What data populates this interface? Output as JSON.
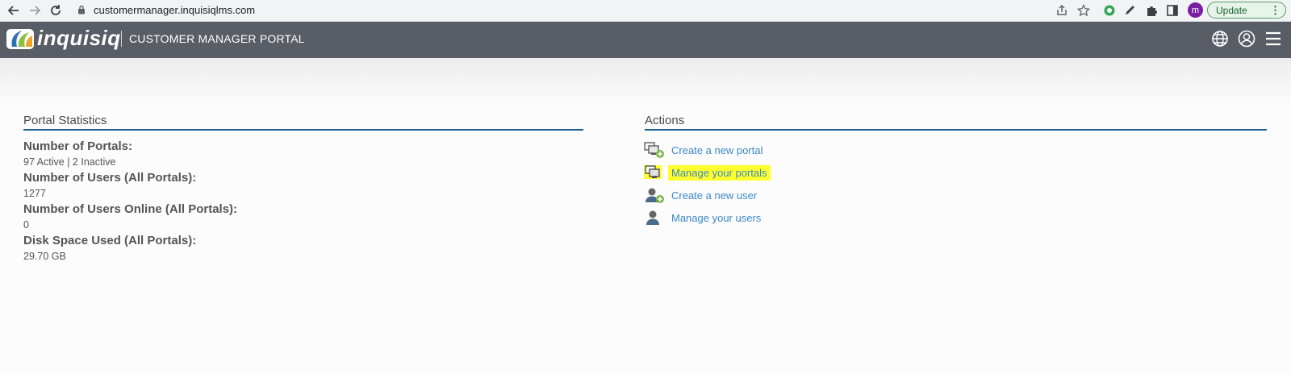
{
  "browser": {
    "url": "customermanager.inquisiqlms.com",
    "profile_initial": "m",
    "update_label": "Update"
  },
  "header": {
    "logo_text": "inquisiq",
    "title": "CUSTOMER MANAGER PORTAL"
  },
  "portal_statistics": {
    "title": "Portal Statistics",
    "stats": [
      {
        "label": "Number of Portals:",
        "value": "97 Active | 2 Inactive"
      },
      {
        "label": "Number of Users (All Portals):",
        "value": "1277"
      },
      {
        "label": "Number of Users Online (All Portals):",
        "value": "0"
      },
      {
        "label": "Disk Space Used (All Portals):",
        "value": "29.70 GB"
      }
    ]
  },
  "actions": {
    "title": "Actions",
    "items": [
      {
        "label": "Create a new portal",
        "icon": "create-portal-icon"
      },
      {
        "label": "Manage your portals",
        "icon": "manage-portals-icon",
        "highlighted": true
      },
      {
        "label": "Create a new user",
        "icon": "create-user-icon"
      },
      {
        "label": "Manage your users",
        "icon": "manage-users-icon"
      }
    ]
  },
  "colors": {
    "header_bg": "#595d66",
    "section_rule": "#1a5e8f",
    "link": "#3b88c8",
    "highlight": "#ffff2e"
  }
}
